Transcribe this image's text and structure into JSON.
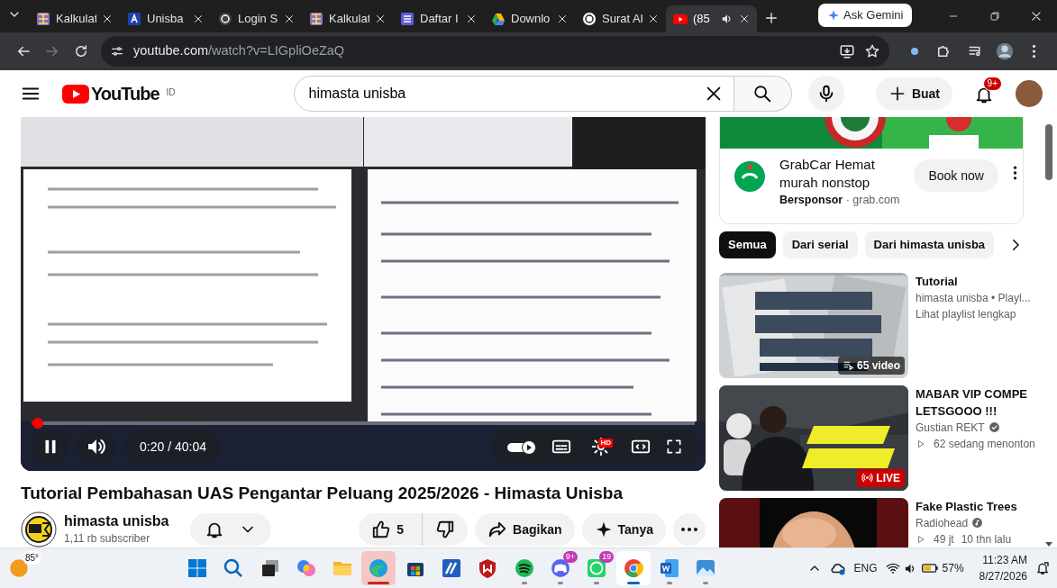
{
  "browser": {
    "tabs": [
      {
        "title": "Kalkulat",
        "selected": false,
        "audio": false
      },
      {
        "title": "Unisba",
        "selected": false,
        "audio": false
      },
      {
        "title": "Login S",
        "selected": false,
        "audio": false
      },
      {
        "title": "Kalkulat",
        "selected": false,
        "audio": false
      },
      {
        "title": "Daftar I",
        "selected": false,
        "audio": false
      },
      {
        "title": "Downlo",
        "selected": false,
        "audio": false
      },
      {
        "title": "Surat Al",
        "selected": false,
        "audio": false
      },
      {
        "title": "(85",
        "selected": true,
        "audio": true
      }
    ],
    "gemini_button": "Ask Gemini",
    "address": {
      "host": "youtube.com",
      "path": "/watch?v=LIGpliOeZaQ"
    }
  },
  "youtube_header": {
    "logo_text": "YouTube",
    "region": "ID",
    "search_value": "himasta unisba",
    "create_button": "Buat",
    "notification_count": "9+"
  },
  "player": {
    "time": "0:20 / 40:04",
    "progress": {
      "level": 0.01
    },
    "playing": true,
    "autoplay_on": true,
    "quality_badge": "HD"
  },
  "video": {
    "title": "Tutorial Pembahasan UAS Pengantar Peluang 2025/2026 - Himasta Unisba",
    "channel": "himasta unisba",
    "subscribers": "1,11 rb subscriber",
    "like_count": "5",
    "share_button": "Bagikan",
    "ask_button": "Tanya"
  },
  "ad": {
    "title": "GrabCar Hemat murah nonstop",
    "sponsor_line": "**Bersponsor** · grab.com",
    "button": "Book now"
  },
  "chips": [
    {
      "label": "Semua",
      "selected": true
    },
    {
      "label": "Dari serial",
      "selected": false
    },
    {
      "label": "Dari himasta unisba",
      "selected": false
    }
  ],
  "recommendations": [
    {
      "kind": "playlist",
      "title": "Tutorial",
      "channel": "himasta unisba • Playl...",
      "verified": false,
      "meta": [
        "Lihat playlist lengkap"
      ],
      "badge": "65 video"
    },
    {
      "kind": "live",
      "title": "MABAR VIP COMPE LETSGOOO !!!",
      "channel": "Gustian REKT",
      "verified": true,
      "meta": [
        "62 sedang menonton"
      ],
      "badge": "LIVE"
    },
    {
      "kind": "video",
      "title": "Fake Plastic Trees",
      "channel": "Radiohead",
      "verified": true,
      "meta": [
        "49 jt",
        "10 thn lalu"
      ]
    }
  ],
  "taskbar": {
    "weather": "85°",
    "apps": [
      {
        "kind": "start",
        "running": false,
        "active": false,
        "attention": false
      },
      {
        "kind": "search",
        "running": false,
        "active": false,
        "attention": false
      },
      {
        "kind": "taskview",
        "running": false,
        "active": false,
        "attention": false
      },
      {
        "kind": "circles",
        "running": false,
        "active": false,
        "attention": false
      },
      {
        "kind": "folder",
        "running": false,
        "active": false,
        "attention": false
      },
      {
        "kind": "wave",
        "running": false,
        "active": false,
        "attention": true
      },
      {
        "kind": "bag",
        "running": false,
        "active": false,
        "attention": false
      },
      {
        "kind": "slash",
        "running": false,
        "active": false,
        "attention": false
      },
      {
        "kind": "shield",
        "running": false,
        "active": false,
        "attention": false
      },
      {
        "kind": "sound",
        "running": true,
        "active": false,
        "attention": false
      },
      {
        "kind": "controller",
        "running": true,
        "active": false,
        "attention": false,
        "badge": "9+"
      },
      {
        "kind": "phone",
        "running": true,
        "active": false,
        "attention": false,
        "badge": "19"
      },
      {
        "kind": "wheel",
        "running": true,
        "active": true,
        "attention": false
      },
      {
        "kind": "document",
        "running": true,
        "active": false,
        "attention": false
      },
      {
        "kind": "landscape",
        "running": true,
        "active": false,
        "attention": false
      }
    ],
    "language": "ENG",
    "battery": "57%",
    "time": "11:23 AM",
    "date": "8/27/2026"
  }
}
